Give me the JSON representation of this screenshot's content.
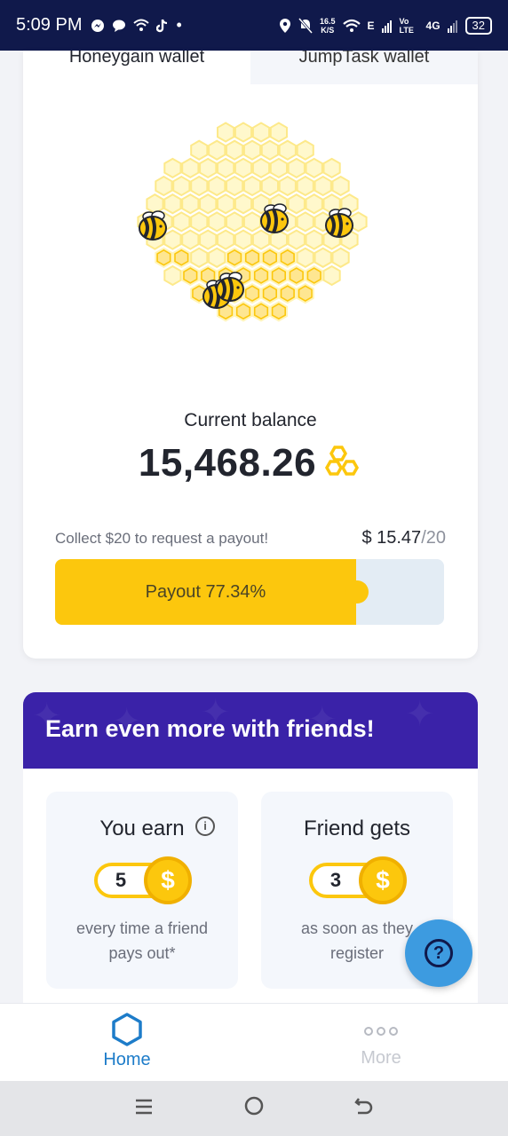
{
  "status_bar": {
    "time": "5:09 PM",
    "speed_value": "16.5",
    "speed_unit": "K/S",
    "net_label_1": "E",
    "net_label_2": "Vo LTE",
    "net_label_3": "4G",
    "battery": "32"
  },
  "wallet": {
    "tab_honeygain": "Honeygain wallet",
    "tab_jumptask": "JumpTask wallet",
    "balance_label": "Current balance",
    "balance_value": "15,468.26",
    "collect_text": "Collect $20 to request a payout!",
    "payout_current": "$ 15.47",
    "payout_target": "/20",
    "progress_label": "Payout 77.34%",
    "progress_fraction": 0.7734
  },
  "friends": {
    "title": "Earn even more with friends!",
    "you_earn_title": "You earn",
    "you_earn_amount": "5",
    "you_earn_desc": "every time a friend pays out*",
    "friend_gets_title": "Friend gets",
    "friend_gets_amount": "3",
    "friend_gets_desc": "as soon as they register",
    "coin_symbol": "$",
    "info_symbol": "i"
  },
  "bottom_nav": {
    "home": "Home",
    "more": "More"
  },
  "colors": {
    "accent_yellow": "#fcc70d",
    "brand_purple": "#3a22a8",
    "status_bar": "#10194b",
    "nav_active": "#1d7cc9",
    "help_fab": "#3d9be0"
  }
}
